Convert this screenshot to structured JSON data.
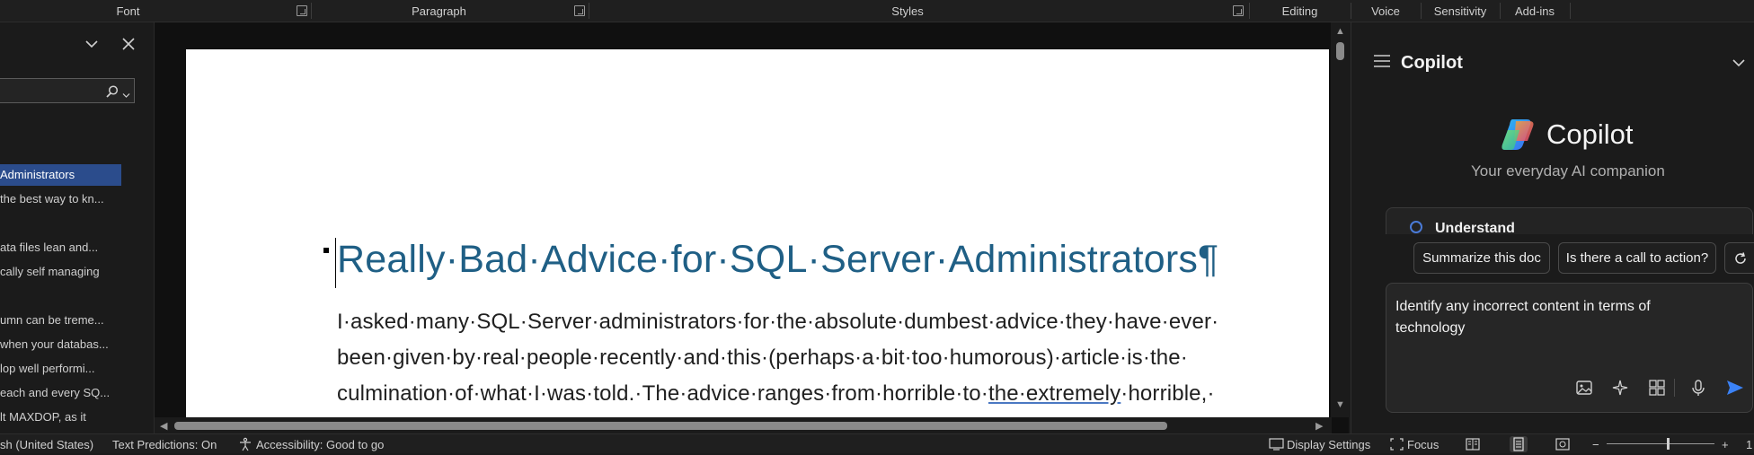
{
  "ribbon": {
    "groups": [
      "Font",
      "Paragraph",
      "Styles",
      "Editing",
      "Voice",
      "Sensitivity",
      "Add-ins"
    ]
  },
  "nav": {
    "items": [
      {
        "label": "Administrators",
        "selected": true
      },
      {
        "label": "the best way to kn...",
        "selected": false
      },
      {
        "label": "ata files lean and...",
        "selected": false
      },
      {
        "label": "cally self managing",
        "selected": false
      },
      {
        "label": "umn can be treme...",
        "selected": false
      },
      {
        "label": "when your databas...",
        "selected": false
      },
      {
        "label": "lop well performi...",
        "selected": false
      },
      {
        "label": "each and every SQ...",
        "selected": false
      },
      {
        "label": "lt MAXDOP, as it",
        "selected": false
      }
    ]
  },
  "document": {
    "title": "Really·Bad·Advice·for·SQL·Server·Administrators¶",
    "line1": "I·asked·many·SQL·Server·administrators·for·the·absolute·dumbest·advice·they·have·ever·",
    "line2": "been·given·by·real·people·recently·and·this·(perhaps·a·bit·too·humorous)·article·is·the·",
    "line3_start": "culmination·of·what·I·was·told.·The·advice·ranges·from·horrible·to·",
    "line3_underlined": "the·extremely",
    "line3_end": "·horrible,·"
  },
  "copilot": {
    "header_title": "Copilot",
    "hero_title": "Copilot",
    "hero_subtitle": "Your everyday AI companion",
    "card_label": "Understand",
    "chips": [
      "Summarize this doc",
      "Is there a call to action?"
    ],
    "input_text": "Identify any incorrect content in terms of technology"
  },
  "status": {
    "language": "sh (United States)",
    "text_predictions": "Text Predictions: On",
    "accessibility": "Accessibility: Good to go",
    "display_settings": "Display Settings",
    "focus": "Focus",
    "zoom_minus": "−",
    "zoom_plus": "+",
    "zoom_value": "1"
  },
  "colors": {
    "accent_selected": "#2b4c8c",
    "title_color": "#1f5f85",
    "send_icon": "#3b82f6"
  }
}
